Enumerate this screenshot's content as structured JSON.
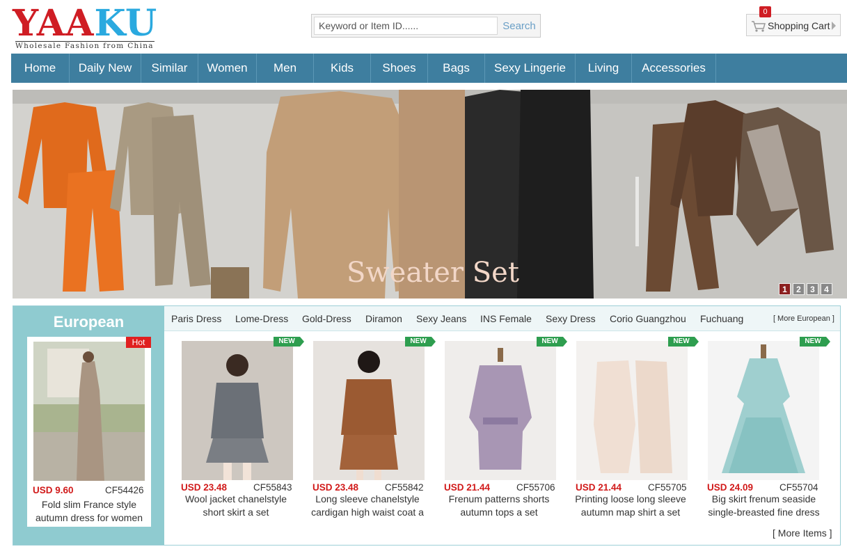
{
  "header": {
    "logo_part_red": "YAA",
    "logo_part_blue": "KU",
    "tagline": "Wholesale Fashion from China",
    "search": {
      "placeholder": "Keyword or Item ID......",
      "button": "Search"
    },
    "cart": {
      "label": "Shopping Cart",
      "count": "0"
    }
  },
  "nav": [
    "Home",
    "Daily New",
    "Similar",
    "Women",
    "Men",
    "Kids",
    "Shoes",
    "Bags",
    "Sexy Lingerie",
    "Living",
    "Accessories"
  ],
  "banner": {
    "caption": "Sweater Set",
    "pages": [
      "1",
      "2",
      "3",
      "4"
    ],
    "active_page": "1"
  },
  "section": {
    "title": "European",
    "featured": {
      "badge": "Hot",
      "price": "USD 9.60",
      "code": "CF54426",
      "title_line1": "Fold slim France style",
      "title_line2": "autumn dress for women"
    },
    "tabs": [
      "Paris Dress",
      "Lome-Dress",
      "Gold-Dress",
      "Diramon",
      "Sexy Jeans",
      "INS Female",
      "Sexy Dress",
      "Corio Guangzhou",
      "Fuchuang"
    ],
    "more_link": "[ More European ]",
    "products": [
      {
        "badge": "NEW",
        "price": "USD 23.48",
        "code": "CF55843",
        "title_line1": "Wool jacket chanelstyle",
        "title_line2": "short skirt a set"
      },
      {
        "badge": "NEW",
        "price": "USD 23.48",
        "code": "CF55842",
        "title_line1": "Long sleeve chanelstyle",
        "title_line2": "cardigan high waist coat a"
      },
      {
        "badge": "NEW",
        "price": "USD 21.44",
        "code": "CF55706",
        "title_line1": "Frenum patterns shorts",
        "title_line2": "autumn tops a set"
      },
      {
        "badge": "NEW",
        "price": "USD 21.44",
        "code": "CF55705",
        "title_line1": "Printing loose long sleeve",
        "title_line2": "autumn map shirt a set"
      },
      {
        "badge": "NEW",
        "price": "USD 24.09",
        "code": "CF55704",
        "title_line1": "Big skirt frenum seaside",
        "title_line2": "single-breasted fine dress"
      }
    ],
    "more_items": "[ More Items ]"
  },
  "colors": {
    "nav_bg": "#3e7e9f",
    "side_bg": "#8fcbd0",
    "price": "#d11a1a",
    "new_badge": "#2e9e4f",
    "hot_badge": "#e02020"
  }
}
